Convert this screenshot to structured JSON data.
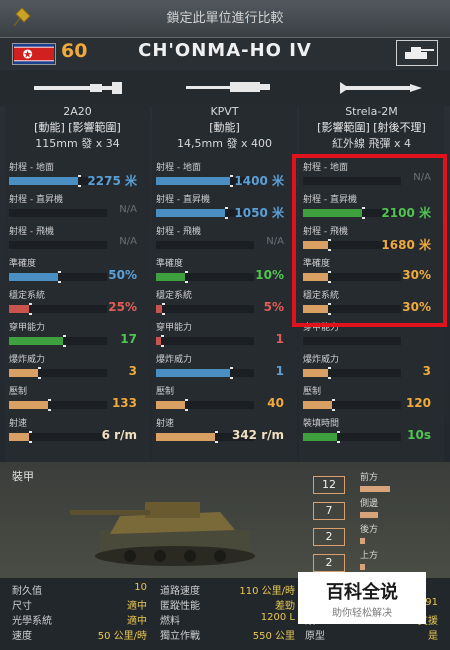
{
  "topbar": {
    "title": "鎖定此單位進行比較",
    "pin_icon": "pin-icon"
  },
  "header": {
    "rank": "60",
    "unit_name": "CH'ONMA-HO IV",
    "flag_icon": "north-korea-flag-icon",
    "type_icon": "tank-type-icon"
  },
  "weapons": [
    {
      "name": "2A20",
      "tags": "[動能] [影響範圍]",
      "ammo": "115mm 發 x 34",
      "stats": [
        {
          "label": "射程 - 地面",
          "value": "2275 米",
          "fill": 0.7,
          "color": "#4a8fc4",
          "valcolor": "#5aa0d6"
        },
        {
          "label": "射程 - 直昇機",
          "value": "N/A",
          "fill": 0,
          "color": "#4a8fc4",
          "valcolor": "#6a6f74"
        },
        {
          "label": "射程 - 飛機",
          "value": "N/A",
          "fill": 0,
          "color": "#4a8fc4",
          "valcolor": "#6a6f74"
        },
        {
          "label": "準確度",
          "value": "50%",
          "fill": 0.5,
          "color": "#4a8fc4",
          "valcolor": "#5aa0d6"
        },
        {
          "label": "穩定系統",
          "value": "25%",
          "fill": 0.2,
          "color": "#c9534f",
          "valcolor": "#e05c55"
        },
        {
          "label": "穿甲能力",
          "value": "17",
          "fill": 0.55,
          "color": "#3fa03f",
          "valcolor": "#52c352"
        },
        {
          "label": "爆炸威力",
          "value": "3",
          "fill": 0.3,
          "color": "#d9a064",
          "valcolor": "#f0a93b"
        },
        {
          "label": "壓制",
          "value": "133",
          "fill": 0.4,
          "color": "#d9a064",
          "valcolor": "#f0a93b"
        },
        {
          "label": "射速",
          "value": "6 r/m",
          "fill": 0.2,
          "color": "#d9a064",
          "valcolor": "#f0e0c0"
        }
      ]
    },
    {
      "name": "KPVT",
      "tags": "[動能]",
      "ammo": "14,5mm 發 x 400",
      "stats": [
        {
          "label": "射程 - 地面",
          "value": "1400 米",
          "fill": 0.75,
          "color": "#4a8fc4",
          "valcolor": "#5aa0d6"
        },
        {
          "label": "射程 - 直昇機",
          "value": "1050 米",
          "fill": 0.7,
          "color": "#4a8fc4",
          "valcolor": "#5aa0d6"
        },
        {
          "label": "射程 - 飛機",
          "value": "N/A",
          "fill": 0,
          "color": "#4a8fc4",
          "valcolor": "#6a6f74"
        },
        {
          "label": "準確度",
          "value": "10%",
          "fill": 0.3,
          "color": "#3fa03f",
          "valcolor": "#52c352"
        },
        {
          "label": "穩定系統",
          "value": "5%",
          "fill": 0.06,
          "color": "#c9534f",
          "valcolor": "#e05c55"
        },
        {
          "label": "穿甲能力",
          "value": "1",
          "fill": 0.05,
          "color": "#c9534f",
          "valcolor": "#e05c55"
        },
        {
          "label": "爆炸威力",
          "value": "1",
          "fill": 0.75,
          "color": "#4a8fc4",
          "valcolor": "#5aa0d6"
        },
        {
          "label": "壓制",
          "value": "40",
          "fill": 0.3,
          "color": "#d9a064",
          "valcolor": "#f0a93b"
        },
        {
          "label": "射速",
          "value": "342 r/m",
          "fill": 0.6,
          "color": "#d9a064",
          "valcolor": "#f0e0c0"
        }
      ]
    },
    {
      "name": "Strela-2M",
      "tags": "[影響範圍] [射後不理]",
      "ammo": "紅外線 飛彈 x 4",
      "stats": [
        {
          "label": "射程 - 地面",
          "value": "N/A",
          "fill": 0,
          "color": "#4a8fc4",
          "valcolor": "#6a6f74"
        },
        {
          "label": "射程 - 直昇機",
          "value": "2100 米",
          "fill": 0.6,
          "color": "#3fa03f",
          "valcolor": "#52c352"
        },
        {
          "label": "射程 - 飛機",
          "value": "1680 米",
          "fill": 0.25,
          "color": "#d9a064",
          "valcolor": "#f0a93b"
        },
        {
          "label": "準確度",
          "value": "30%",
          "fill": 0.25,
          "color": "#d9a064",
          "valcolor": "#f0a93b"
        },
        {
          "label": "穩定系統",
          "value": "30%",
          "fill": 0.25,
          "color": "#d9a064",
          "valcolor": "#f0a93b"
        },
        {
          "label": "穿甲能力",
          "value": "",
          "fill": 0,
          "color": "#4a8fc4",
          "valcolor": "#6a6f74"
        },
        {
          "label": "爆炸威力",
          "value": "3",
          "fill": 0.25,
          "color": "#d9a064",
          "valcolor": "#f0a93b"
        },
        {
          "label": "壓制",
          "value": "120",
          "fill": 0.3,
          "color": "#d9a064",
          "valcolor": "#f0a93b"
        },
        {
          "label": "裝填時間",
          "value": "10s",
          "fill": 0.35,
          "color": "#3fa03f",
          "valcolor": "#52c352"
        }
      ]
    }
  ],
  "armor": {
    "label": "裝甲",
    "rows": [
      {
        "value": "12",
        "dir": "前方",
        "fill": 0.33
      },
      {
        "value": "7",
        "dir": "側邊",
        "fill": 0.2
      },
      {
        "value": "2",
        "dir": "後方",
        "fill": 0.06
      },
      {
        "value": "2",
        "dir": "上方",
        "fill": 0.06
      }
    ]
  },
  "bottom": [
    {
      "l": "耐久值",
      "v": "10"
    },
    {
      "l": "道路速度",
      "v": "110 公里/時"
    },
    {
      "l": "尺寸",
      "v": "適中"
    },
    {
      "l": "匿蹤性能",
      "v": "差勁"
    },
    {
      "l": "光學系統",
      "v": "適中"
    },
    {
      "l": "燃料",
      "v": "1200 L"
    },
    {
      "l": "速度",
      "v": "50 公里/時"
    },
    {
      "l": "獨立作戰",
      "v": "550 公里"
    }
  ],
  "bottom_right": [
    {
      "l": "年",
      "v": "1991"
    },
    {
      "l": "類",
      "v": "支援"
    },
    {
      "l": "原型",
      "v": "是"
    }
  ],
  "watermark": {
    "line1": "百科全说",
    "line2": "助你轻松解决"
  },
  "colors": {
    "accent": "#f0a93b",
    "highlight": "#e0121c"
  }
}
